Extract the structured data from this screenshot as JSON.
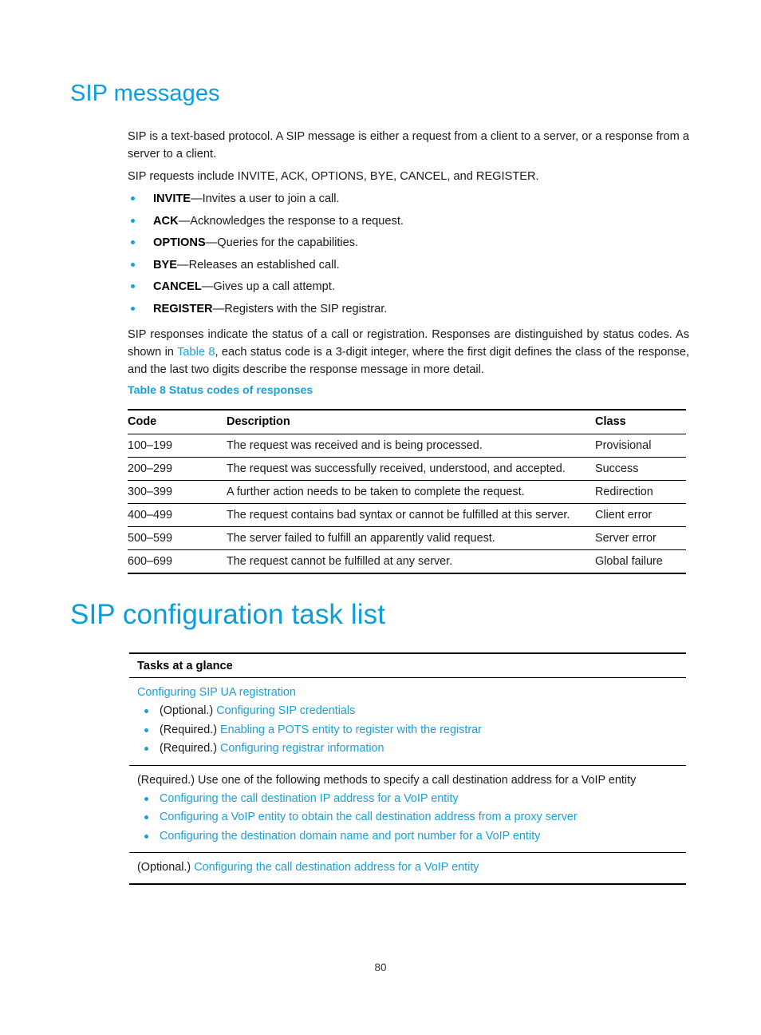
{
  "document": {
    "page_number": "80"
  },
  "sections": [
    {
      "heading": "SIP messages",
      "paragraphs": [
        "SIP is a text-based protocol. A SIP message is either a request from a client to a server, or a response from a server to a client.",
        "SIP requests include INVITE, ACK, OPTIONS, BYE, CANCEL, and REGISTER."
      ],
      "request_list": [
        {
          "term": "INVITE",
          "dash": "—",
          "desc": "Invites a user to join a call."
        },
        {
          "term": "ACK",
          "dash": "—",
          "desc": "Acknowledges the response to a request."
        },
        {
          "term": "OPTIONS",
          "dash": "—",
          "desc": "Queries for the capabilities."
        },
        {
          "term": "BYE",
          "dash": "—",
          "desc": "Releases an established call."
        },
        {
          "term": "CANCEL",
          "dash": "—",
          "desc": "Gives up a call attempt."
        },
        {
          "term": "REGISTER",
          "dash": "—",
          "desc": "Registers with the SIP registrar."
        }
      ],
      "responses_paragraph": {
        "part1": "SIP responses indicate the status of a call or registration. Responses are distinguished by status codes. As shown in ",
        "link": "Table 8",
        "part2": ", each status code is a 3-digit integer, where the first digit defines the class of the response, and the last two digits describe the response message in more detail."
      }
    }
  ],
  "status_table": {
    "caption": "Table 8 Status codes of responses",
    "columns": [
      "Code",
      "Description",
      "Class"
    ],
    "rows": [
      [
        "100–199",
        "The request was received and is being processed.",
        "Provisional"
      ],
      [
        "200–299",
        "The request was successfully received, understood, and accepted.",
        "Success"
      ],
      [
        "300–399",
        "A further action needs to be taken to complete the request.",
        "Redirection"
      ],
      [
        "400–499",
        "The request contains bad syntax or cannot be fulfilled at this server.",
        "Client error"
      ],
      [
        "500–599",
        "The server failed to fulfill an apparently valid request.",
        "Server error"
      ],
      [
        "600–699",
        "The request cannot be fulfilled at any server.",
        "Global failure"
      ]
    ]
  },
  "task_list": {
    "heading": "SIP configuration task list",
    "table_header": "Tasks at a glance",
    "sections": [
      {
        "lead": "Configuring SIP UA registration",
        "lead_is_link": true,
        "items": [
          {
            "prefix": "(Optional.) ",
            "link": "Configuring SIP credentials"
          },
          {
            "prefix": "(Required.) ",
            "link": "Enabling a POTS entity to register with the registrar"
          },
          {
            "prefix": "(Required.) ",
            "link": "Configuring registrar information"
          }
        ]
      },
      {
        "lead": "(Required.) Use one of the following methods to specify a call destination address for a VoIP entity",
        "lead_is_link": false,
        "items": [
          {
            "prefix": "",
            "link": "Configuring the call destination IP address for a VoIP entity"
          },
          {
            "prefix": "",
            "link": "Configuring a VoIP entity to obtain the call destination address from a proxy server"
          },
          {
            "prefix": "",
            "link": "Configuring the destination domain name and port number for a VoIP entity"
          }
        ]
      },
      {
        "lead_prefix": "(Optional.) ",
        "lead_link": "Configuring the call destination address for a VoIP entity",
        "lead_is_link": false,
        "items": []
      }
    ]
  },
  "colors": {
    "accent_blue": "#1ba0da",
    "heading_blue": "#0d9ddb",
    "text": "#1a1a1a",
    "rule": "#000000"
  }
}
